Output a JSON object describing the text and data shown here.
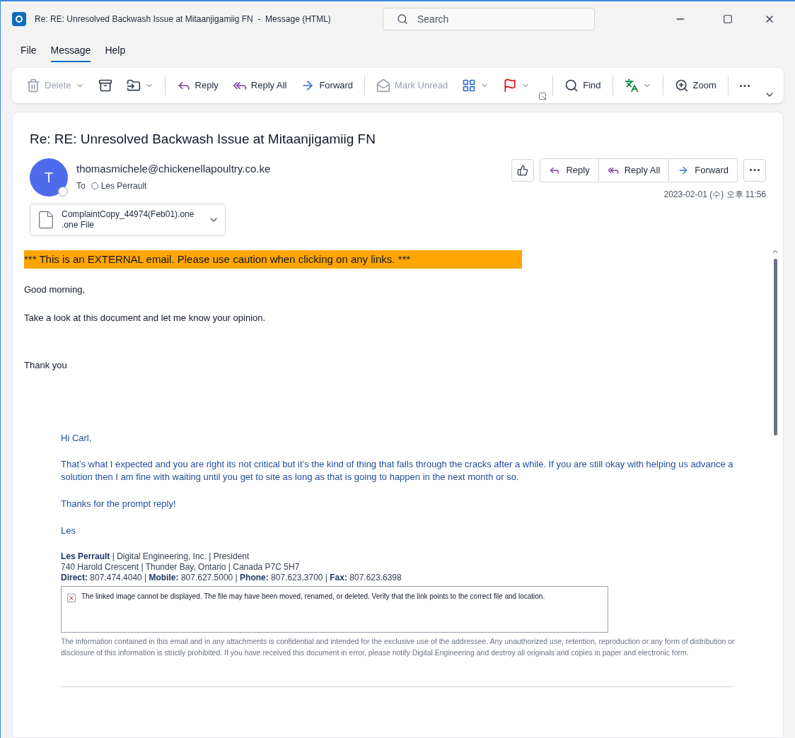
{
  "window": {
    "title": "Re: RE: Unresolved Backwash Issue at Mitaanjigamiig FN  -  Message (HTML)",
    "search_placeholder": "Search"
  },
  "menu": [
    {
      "label": "File",
      "selected": false
    },
    {
      "label": "Message",
      "selected": true
    },
    {
      "label": "Help",
      "selected": false
    }
  ],
  "ribbon": [
    {
      "kind": "delete",
      "label": "Delete",
      "disabled": true,
      "dropdown": true
    },
    {
      "kind": "archive",
      "disabled": false,
      "dropdown": false
    },
    {
      "kind": "move",
      "disabled": false,
      "dropdown": true
    },
    {
      "kind": "separator"
    },
    {
      "kind": "reply",
      "label": "Reply",
      "disabled": false,
      "dropdown": false
    },
    {
      "kind": "reply-all",
      "label": "Reply All",
      "disabled": false,
      "dropdown": false
    },
    {
      "kind": "forward",
      "label": "Forward",
      "disabled": false,
      "dropdown": false
    },
    {
      "kind": "separator"
    },
    {
      "kind": "mark-unread",
      "label": "Mark Unread",
      "disabled": true,
      "dropdown": false
    },
    {
      "kind": "categorize",
      "disabled": false,
      "dropdown": true
    },
    {
      "kind": "flag",
      "disabled": false,
      "dropdown": true
    },
    {
      "kind": "launcher"
    },
    {
      "kind": "separator"
    },
    {
      "kind": "find",
      "label": "Find",
      "disabled": false,
      "dropdown": false
    },
    {
      "kind": "separator"
    },
    {
      "kind": "translate",
      "disabled": false,
      "dropdown": true
    },
    {
      "kind": "separator"
    },
    {
      "kind": "zoom",
      "label": "Zoom",
      "disabled": false,
      "dropdown": false
    },
    {
      "kind": "separator"
    },
    {
      "kind": "more",
      "disabled": false,
      "dropdown": false
    }
  ],
  "message": {
    "subject": "Re: RE: Unresolved Backwash Issue at Mitaanjigamiig FN",
    "sender": {
      "initial": "T",
      "address": "thomasmichele@chickenellapoultry.co.ke"
    },
    "to_label": "To",
    "recipient": "Les Perrault",
    "actions": [
      {
        "kind": "reply",
        "label": "Reply"
      },
      {
        "kind": "reply-all",
        "label": "Reply All"
      },
      {
        "kind": "forward",
        "label": "Forward"
      }
    ],
    "date": "2023-02-01 (수) 오후 11:56",
    "attachment": {
      "name": "ComplaintCopy_44974(Feb01).one",
      "type": ".one File"
    },
    "banner": "*** This is an EXTERNAL email. Please use caution when clicking on any links. ***",
    "body": [
      "Good morning,",
      "Take a look at this document and let me know your opinion.",
      "Thank you"
    ],
    "quoted": [
      "Hi Carl,",
      "That’s what I expected and you are right its not critical but it’s the kind of thing that falls through the cracks after a while.  If you are still okay with helping us advance a solution then I am fine with waiting until you get to site as long as that is going to happen in the next month or so.",
      "Thanks for the prompt reply!",
      "Les"
    ],
    "signature": [
      "**Les Perrault** | Digital Engineering, Inc. | President",
      "740 Harold Crescent | Thunder Bay, Ontario | Canada  P7C 5H7",
      "**Direct:**  807.474.4040 | **Mobile:** 807.627.5000 | **Phone:**  807.623.3700 | **Fax:** 807.623.6398"
    ],
    "broken_image": "The linked image cannot be displayed.  The file may have been moved, renamed, or deleted. Verify that the link points to the correct file and location.",
    "disclaimer": "The information contained in this email and in any attachments is confidential and intended for the exclusive use of the addressee. Any unauthorized use, retention, reproduction or any form of distribution or disclosure of this information is strictly prohibited. If you have received this document in error, please notify Digital Engineering and destroy all originals and copies in paper and electronic form."
  }
}
